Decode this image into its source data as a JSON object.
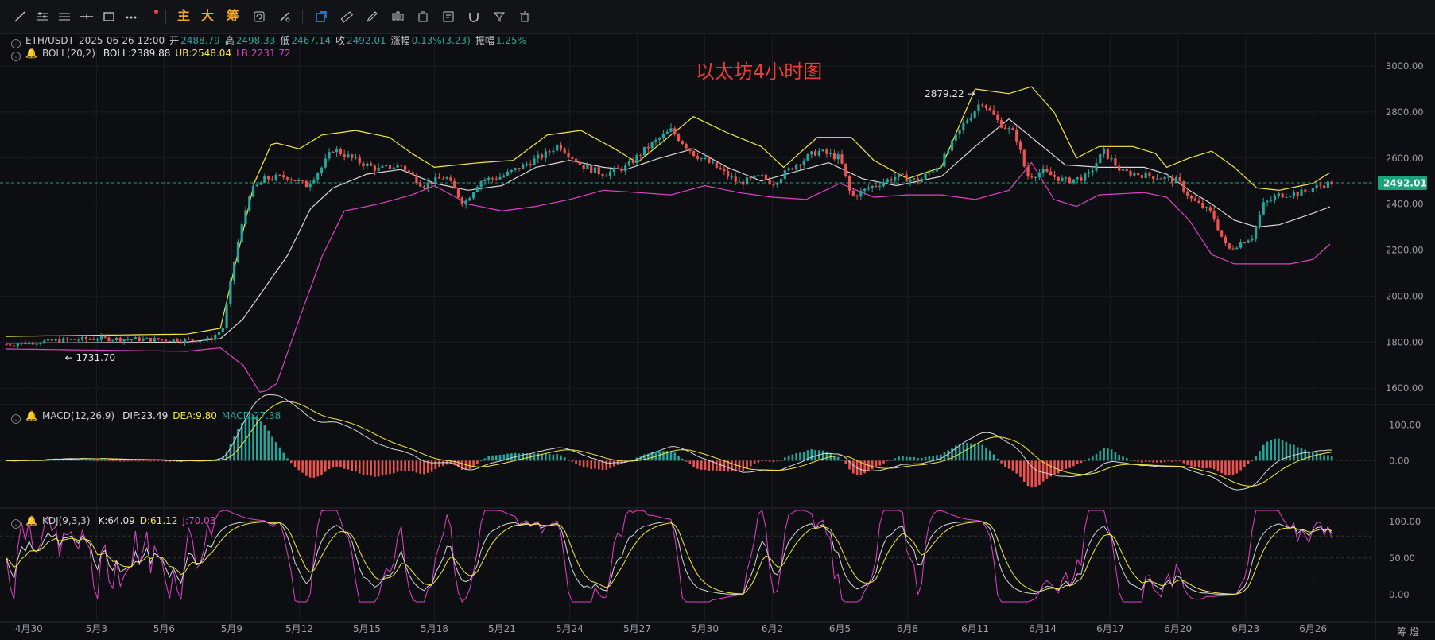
{
  "toolbar": {
    "tools": [
      "line-tool",
      "multi-line-tool",
      "parallel-tool",
      "horizontal-line-tool",
      "rectangle-tool",
      "more-tool"
    ],
    "indicator_main": "主",
    "indicator_big": "大",
    "indicator_chip": "筹",
    "right_tools": [
      "cursor-tool",
      "ruler-tool",
      "pen-tool",
      "indicator-tool",
      "clone-tool",
      "edit-tool",
      "magnet-tool",
      "filter-tool",
      "trash-tool"
    ]
  },
  "colors": {
    "up": "#26a69a",
    "down": "#ef5350",
    "yellow": "#f5e642",
    "white": "#d8d8d8",
    "magenta": "#e040c8",
    "price_tag": "#1aa37a",
    "title": "#ec3b3b"
  },
  "header": {
    "symbol": "ETH/USDT",
    "datetime": "2025-06-26 12:00",
    "open_label": "开",
    "open": "2488.79",
    "high_label": "高",
    "high": "2498.33",
    "low_label": "低",
    "low": "2467.14",
    "close_label": "收",
    "close": "2492.01",
    "change_label": "涨幅",
    "change": "0.13%(3.23)",
    "amp_label": "振幅",
    "amp": "1.25%"
  },
  "boll_legend": {
    "name": "BOLL(20,2)",
    "mid": "BOLL:2389.88",
    "ub": "UB:2548.04",
    "lb": "LB:2231.72"
  },
  "macd_legend": {
    "name": "MACD(12,26,9)",
    "dif": "DIF:23.49",
    "dea": "DEA:9.80",
    "macd": "MACD:27.38"
  },
  "kdj_legend": {
    "name": "KDJ(9,3,3)",
    "k": "K:64.09",
    "d": "D:61.12",
    "j": "J:70.03"
  },
  "chart_title": "以太坊4小时图",
  "bottom_right": "筹 燈",
  "chart_data": {
    "type": "candlestick",
    "title": "以太坊4小时图",
    "price_axis": {
      "ticks": [
        1600,
        1800,
        2000,
        2200,
        2400,
        2600,
        2800,
        3000
      ],
      "tick_labels": [
        "1600.00",
        "1800.00",
        "2000.00",
        "2200.00",
        "2400.00",
        "2600.00",
        "2800.00",
        "3000.00"
      ],
      "range": [
        1535,
        3045
      ]
    },
    "last_price": "2492.01",
    "annotations": {
      "high": "2879.22",
      "low": "1731.70"
    },
    "x_tick_labels": [
      "4月30",
      "5月3",
      "5月6",
      "5月9",
      "5月12",
      "5月15",
      "5月18",
      "5月21",
      "5月24",
      "5月27",
      "5月30",
      "6月2",
      "6月5",
      "6月8",
      "6月11",
      "6月14",
      "6月17",
      "6月20",
      "6月23",
      "6月26"
    ],
    "x_range_days": [
      0,
      59
    ],
    "close_path": [
      [
        0,
        1790
      ],
      [
        2,
        1805
      ],
      [
        4,
        1815
      ],
      [
        6,
        1812
      ],
      [
        8,
        1808
      ],
      [
        9,
        1810
      ],
      [
        9.6,
        1860
      ],
      [
        10.2,
        2200
      ],
      [
        10.8,
        2450
      ],
      [
        11.5,
        2510
      ],
      [
        12.5,
        2520
      ],
      [
        13.3,
        2480
      ],
      [
        14,
        2560
      ],
      [
        14.5,
        2640
      ],
      [
        15.5,
        2590
      ],
      [
        16.5,
        2550
      ],
      [
        17.5,
        2570
      ],
      [
        18.5,
        2480
      ],
      [
        19.5,
        2520
      ],
      [
        20.3,
        2400
      ],
      [
        21,
        2500
      ],
      [
        22,
        2520
      ],
      [
        23,
        2570
      ],
      [
        24,
        2620
      ],
      [
        24.5,
        2660
      ],
      [
        25.5,
        2570
      ],
      [
        26.5,
        2530
      ],
      [
        27.5,
        2560
      ],
      [
        28.5,
        2650
      ],
      [
        29.5,
        2720
      ],
      [
        30.5,
        2620
      ],
      [
        31.5,
        2560
      ],
      [
        32.5,
        2490
      ],
      [
        33.5,
        2520
      ],
      [
        34,
        2490
      ],
      [
        35,
        2570
      ],
      [
        36,
        2630
      ],
      [
        37,
        2600
      ],
      [
        37.5,
        2430
      ],
      [
        38.5,
        2480
      ],
      [
        39.5,
        2520
      ],
      [
        40.5,
        2500
      ],
      [
        41.5,
        2580
      ],
      [
        42.5,
        2750
      ],
      [
        43.3,
        2850
      ],
      [
        44,
        2760
      ],
      [
        44.8,
        2700
      ],
      [
        45.3,
        2520
      ],
      [
        46,
        2540
      ],
      [
        47,
        2500
      ],
      [
        48,
        2520
      ],
      [
        48.7,
        2630
      ],
      [
        49.5,
        2540
      ],
      [
        51,
        2520
      ],
      [
        52,
        2500
      ],
      [
        52.6,
        2420
      ],
      [
        53.5,
        2360
      ],
      [
        54.2,
        2200
      ],
      [
        55.3,
        2260
      ],
      [
        55.8,
        2400
      ],
      [
        56.5,
        2440
      ],
      [
        57.5,
        2450
      ],
      [
        58.3,
        2480
      ],
      [
        58.8,
        2492
      ]
    ],
    "boll_upper_path": [
      [
        0,
        1825
      ],
      [
        8,
        1835
      ],
      [
        9.5,
        1860
      ],
      [
        11,
        2490
      ],
      [
        11.8,
        2670
      ],
      [
        13,
        2640
      ],
      [
        14,
        2700
      ],
      [
        15.5,
        2720
      ],
      [
        17,
        2690
      ],
      [
        18,
        2620
      ],
      [
        19,
        2560
      ],
      [
        20,
        2570
      ],
      [
        21,
        2580
      ],
      [
        22.5,
        2590
      ],
      [
        24,
        2700
      ],
      [
        25.5,
        2720
      ],
      [
        27,
        2640
      ],
      [
        28,
        2580
      ],
      [
        29.5,
        2700
      ],
      [
        30.5,
        2780
      ],
      [
        32,
        2710
      ],
      [
        33.5,
        2650
      ],
      [
        34.5,
        2560
      ],
      [
        36,
        2690
      ],
      [
        37.5,
        2690
      ],
      [
        38.5,
        2590
      ],
      [
        40,
        2510
      ],
      [
        41.5,
        2560
      ],
      [
        43,
        2900
      ],
      [
        44.5,
        2880
      ],
      [
        45.5,
        2910
      ],
      [
        46.5,
        2800
      ],
      [
        47.5,
        2600
      ],
      [
        48.5,
        2650
      ],
      [
        50,
        2650
      ],
      [
        51,
        2620
      ],
      [
        51.5,
        2560
      ],
      [
        52.5,
        2600
      ],
      [
        53.5,
        2630
      ],
      [
        54.5,
        2560
      ],
      [
        55.5,
        2470
      ],
      [
        56.5,
        2460
      ],
      [
        58,
        2490
      ],
      [
        58.8,
        2540
      ]
    ],
    "boll_mid_path": [
      [
        0,
        1795
      ],
      [
        8,
        1800
      ],
      [
        9.5,
        1815
      ],
      [
        10.5,
        1900
      ],
      [
        12.5,
        2180
      ],
      [
        13.5,
        2380
      ],
      [
        14.5,
        2470
      ],
      [
        16,
        2530
      ],
      [
        17.5,
        2550
      ],
      [
        19,
        2490
      ],
      [
        20.5,
        2460
      ],
      [
        22,
        2480
      ],
      [
        23.5,
        2560
      ],
      [
        25,
        2590
      ],
      [
        26.5,
        2560
      ],
      [
        27.5,
        2550
      ],
      [
        29,
        2600
      ],
      [
        30.5,
        2640
      ],
      [
        32,
        2560
      ],
      [
        33.5,
        2500
      ],
      [
        35,
        2540
      ],
      [
        36.5,
        2580
      ],
      [
        38,
        2510
      ],
      [
        39.5,
        2480
      ],
      [
        41.5,
        2520
      ],
      [
        43,
        2650
      ],
      [
        44.5,
        2770
      ],
      [
        45.5,
        2690
      ],
      [
        47,
        2570
      ],
      [
        48.5,
        2560
      ],
      [
        50.5,
        2560
      ],
      [
        51.5,
        2530
      ],
      [
        52.5,
        2460
      ],
      [
        53.5,
        2400
      ],
      [
        54.5,
        2330
      ],
      [
        55.5,
        2300
      ],
      [
        56.5,
        2310
      ],
      [
        58,
        2360
      ],
      [
        58.8,
        2390
      ]
    ],
    "boll_lower_path": [
      [
        0,
        1770
      ],
      [
        8,
        1760
      ],
      [
        9.5,
        1775
      ],
      [
        10.5,
        1700
      ],
      [
        11.3,
        1575
      ],
      [
        12,
        1620
      ],
      [
        13,
        1900
      ],
      [
        14,
        2170
      ],
      [
        15,
        2370
      ],
      [
        16.5,
        2400
      ],
      [
        18,
        2440
      ],
      [
        19,
        2480
      ],
      [
        20.5,
        2400
      ],
      [
        22,
        2370
      ],
      [
        23.5,
        2390
      ],
      [
        25,
        2420
      ],
      [
        26.5,
        2460
      ],
      [
        28,
        2450
      ],
      [
        29.5,
        2440
      ],
      [
        31,
        2480
      ],
      [
        32.5,
        2450
      ],
      [
        34,
        2430
      ],
      [
        35.5,
        2420
      ],
      [
        37,
        2490
      ],
      [
        38.5,
        2430
      ],
      [
        40,
        2440
      ],
      [
        41.5,
        2440
      ],
      [
        43,
        2420
      ],
      [
        44.5,
        2460
      ],
      [
        45.5,
        2580
      ],
      [
        46.5,
        2420
      ],
      [
        47.5,
        2390
      ],
      [
        48.5,
        2440
      ],
      [
        50.5,
        2450
      ],
      [
        51.5,
        2430
      ],
      [
        52.5,
        2330
      ],
      [
        53.5,
        2180
      ],
      [
        54.5,
        2140
      ],
      [
        55.5,
        2140
      ],
      [
        57,
        2140
      ],
      [
        58,
        2160
      ],
      [
        58.8,
        2230
      ]
    ],
    "macd": {
      "ticks": [
        0,
        100
      ],
      "tick_labels": [
        "0.00",
        "100.00"
      ],
      "range": [
        -95,
        150
      ],
      "dif": "23.49",
      "dea": "9.80",
      "macd": "27.38"
    },
    "kdj": {
      "ticks": [
        0,
        50,
        100
      ],
      "tick_labels": [
        "0.00",
        "50.00",
        "100.00"
      ],
      "range": [
        -10,
        115
      ],
      "k": "64.09",
      "d": "61.12",
      "j": "70.03"
    }
  }
}
